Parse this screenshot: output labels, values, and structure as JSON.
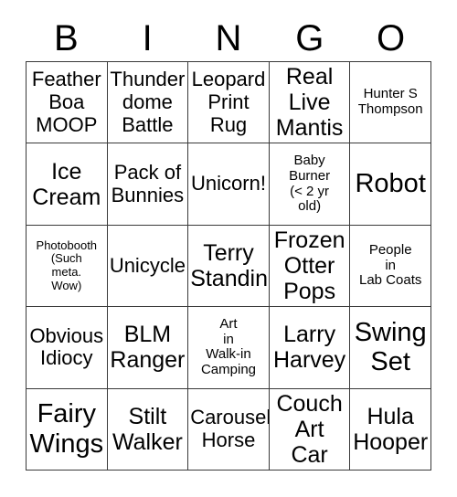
{
  "card": {
    "title_letters": [
      "B",
      "I",
      "N",
      "G",
      "O"
    ],
    "rows": [
      [
        {
          "text": "Feather\nBoa\nMOOP",
          "size": "md"
        },
        {
          "text": "Thunder\ndome\nBattle",
          "size": "md"
        },
        {
          "text": "Leopard\nPrint\nRug",
          "size": "md"
        },
        {
          "text": "Real\nLive\nMantis",
          "size": "lg"
        },
        {
          "text": "Hunter S\nThompson",
          "size": "sm"
        }
      ],
      [
        {
          "text": "Ice\nCream",
          "size": "lg"
        },
        {
          "text": "Pack of\nBunnies",
          "size": "md"
        },
        {
          "text": "Unicorn!",
          "size": "md"
        },
        {
          "text": "Baby\nBurner\n(< 2 yr\nold)",
          "size": "sm"
        },
        {
          "text": "Robot",
          "size": "xl"
        }
      ],
      [
        {
          "text": "Photobooth\n(Such\nmeta.\nWow)",
          "size": "xs"
        },
        {
          "text": "Unicycle",
          "size": "md"
        },
        {
          "text": "Terry\nStandin",
          "size": "lg"
        },
        {
          "text": "Frozen\nOtter\nPops",
          "size": "lg"
        },
        {
          "text": "People\nin\nLab Coats",
          "size": "sm"
        }
      ],
      [
        {
          "text": "Obvious\nIdiocy",
          "size": "md"
        },
        {
          "text": "BLM\nRanger",
          "size": "lg"
        },
        {
          "text": "Art\nin\nWalk-in\nCamping",
          "size": "sm"
        },
        {
          "text": "Larry\nHarvey",
          "size": "lg"
        },
        {
          "text": "Swing\nSet",
          "size": "xl"
        }
      ],
      [
        {
          "text": "Fairy\nWings",
          "size": "xl"
        },
        {
          "text": "Stilt\nWalker",
          "size": "lg"
        },
        {
          "text": "Carousel\nHorse",
          "size": "md"
        },
        {
          "text": "Couch\nArt\nCar",
          "size": "lg"
        },
        {
          "text": "Hula\nHooper",
          "size": "lg"
        }
      ]
    ]
  }
}
